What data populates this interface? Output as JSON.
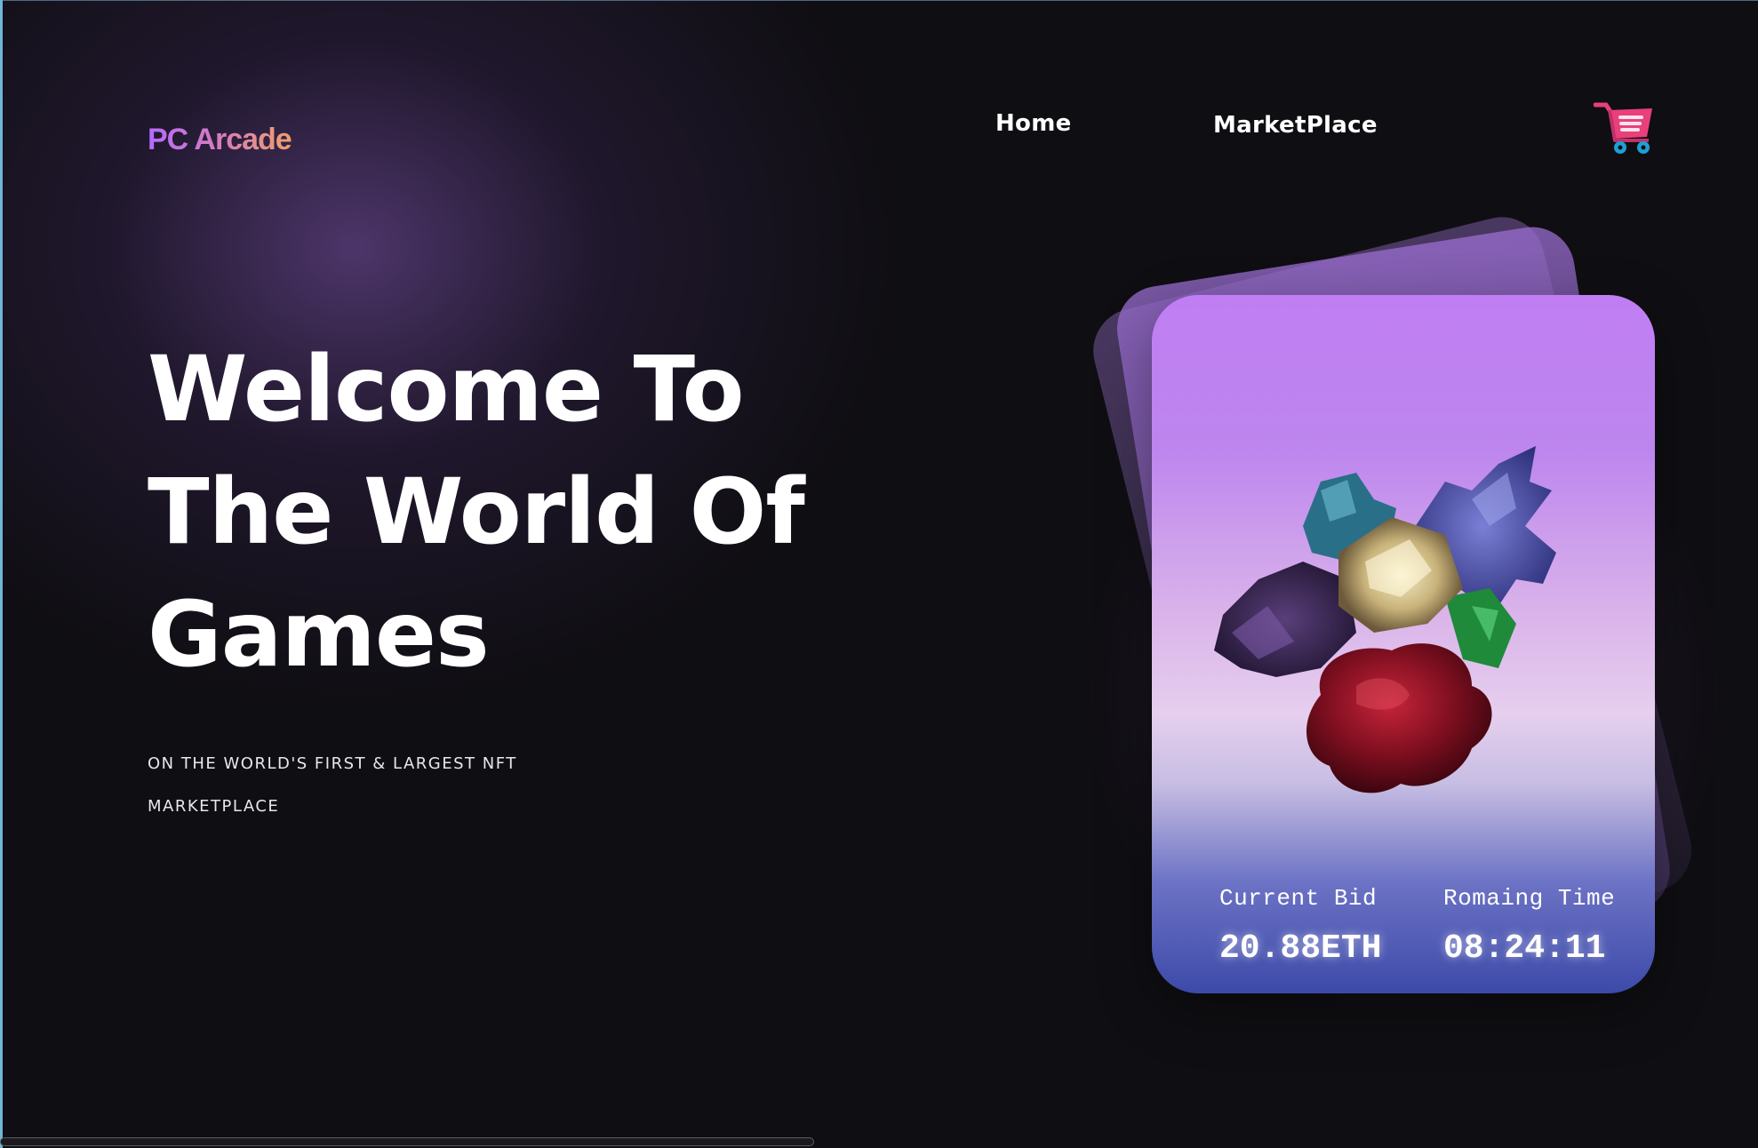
{
  "brand": {
    "logo_text": "PC Arcade"
  },
  "nav": {
    "home_label": "Home",
    "marketplace_label": "MarketPlace",
    "cart_icon": "shopping-cart-icon"
  },
  "hero": {
    "title_lines": [
      "Welcome To",
      "The World Of",
      "Games"
    ],
    "subtitle_lines": [
      "ON THE WORLD'S FIRST & LARGEST NFT",
      "MARKETPLACE"
    ]
  },
  "card": {
    "bid_label": "Current Bid",
    "bid_value": "20.88ETH",
    "time_label": "Romaing Time",
    "time_value": "08:24:11"
  },
  "colors": {
    "background": "#0f0e12",
    "logo_gradient": [
      "#b46bff",
      "#f0a06a"
    ],
    "card_top": "#c07ef2",
    "card_bottom": "#3c4aa8",
    "cart_pink": "#e8407a",
    "cart_wheels": "#1e9fd6"
  }
}
